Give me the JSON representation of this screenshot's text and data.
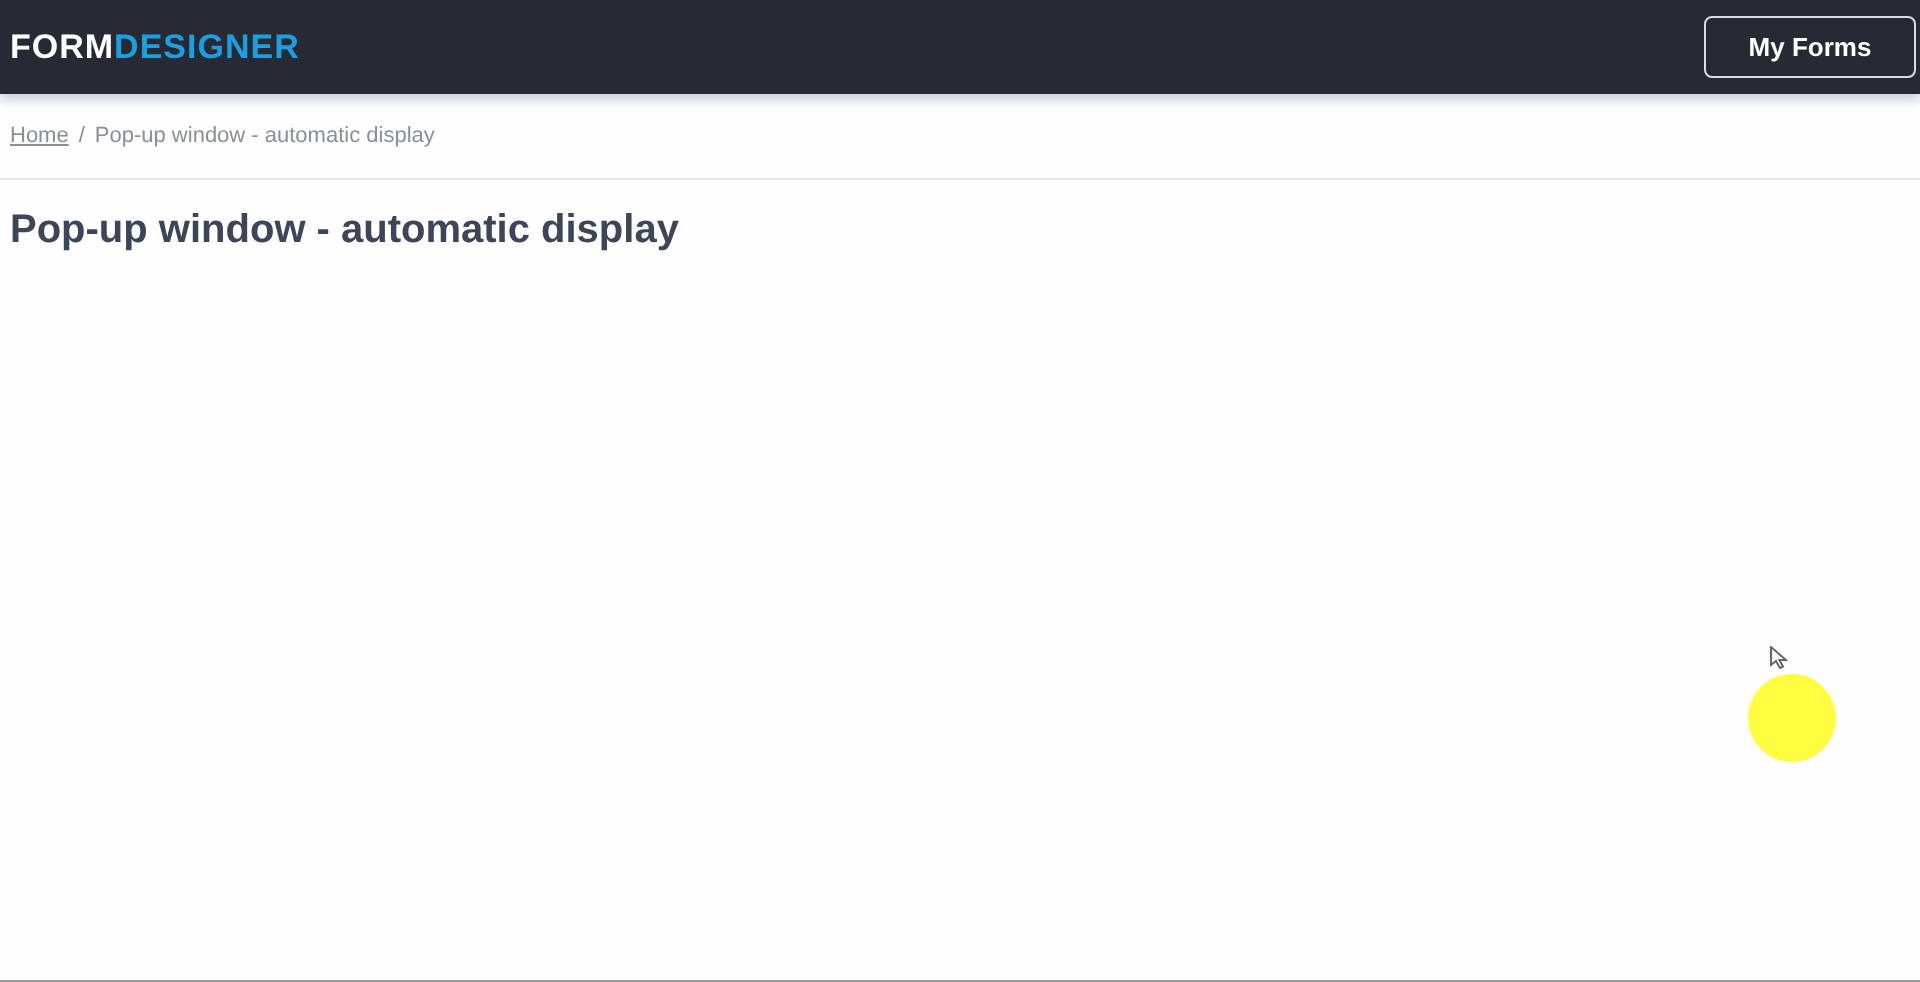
{
  "header": {
    "logo": {
      "part_1": "FORM",
      "part_2": "DESIGNER"
    },
    "button": "My Forms"
  },
  "breadcrumb": [
    {
      "label": "Home",
      "kind": "link"
    },
    {
      "label": "/",
      "kind": "separator"
    },
    {
      "label": "Pop-up window - automatic display",
      "kind": "current"
    }
  ],
  "title": "Pop-up window - automatic display"
}
